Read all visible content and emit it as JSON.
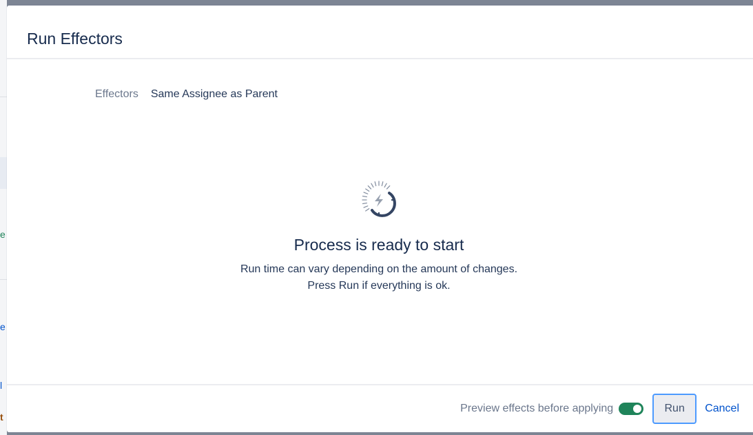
{
  "dialog": {
    "title": "Run Effectors"
  },
  "fields": {
    "effectors_label": "Effectors",
    "effectors_value": "Same Assignee as Parent"
  },
  "status": {
    "icon": "lightning-progress-icon",
    "title": "Process is ready to start",
    "line1": "Run time can vary depending on the amount of changes.",
    "line2": "Press Run if everything is ok."
  },
  "footer": {
    "preview_label": "Preview effects before applying",
    "preview_enabled": true,
    "run_label": "Run",
    "cancel_label": "Cancel"
  },
  "backdrop": {
    "peek_1": "e",
    "peek_2": "e",
    "peek_3": "l",
    "peek_4": "t"
  },
  "colors": {
    "toggle_on": "#1f845a",
    "link": "#0052cc",
    "focus_ring": "#4c9aff",
    "overlay": "#7d8594"
  }
}
